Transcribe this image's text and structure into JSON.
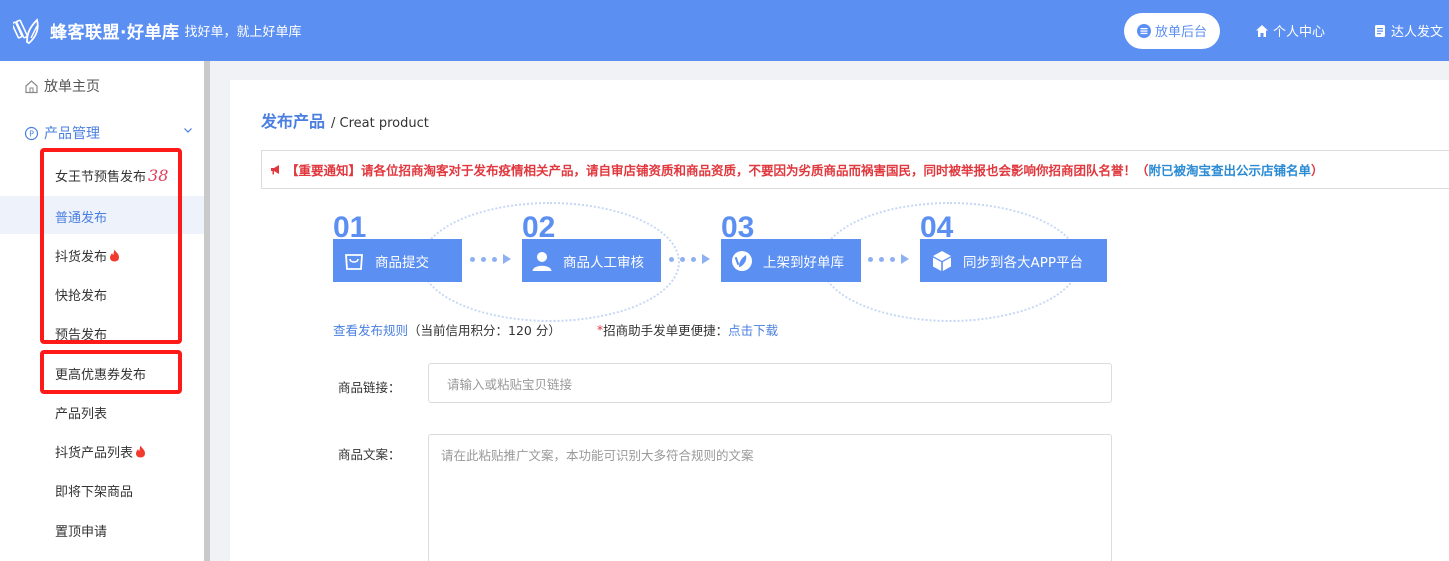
{
  "header": {
    "brand": "蜂客联盟·好单库",
    "slogan": "找好单，就上好单库",
    "nav": {
      "backend": "放单后台",
      "personal": "个人中心",
      "creator": "达人发文"
    },
    "colors": {
      "primary": "#5b8ff2"
    }
  },
  "sidebar": {
    "home": "放单主页",
    "product_mgmt": "产品管理",
    "items": [
      {
        "label": "女王节预售发布",
        "badge": "38"
      },
      {
        "label": "普通发布"
      },
      {
        "label": "抖货发布"
      },
      {
        "label": "快抢发布"
      },
      {
        "label": "预告发布"
      },
      {
        "label": "更高优惠券发布"
      },
      {
        "label": "产品列表"
      },
      {
        "label": "抖货产品列表"
      },
      {
        "label": "即将下架商品"
      },
      {
        "label": "置顶申请"
      }
    ]
  },
  "main": {
    "title": "发布产品",
    "subtitle": "/ Creat product",
    "notice": {
      "text": "【重要通知】请各位招商淘客对于发布疫情相关产品，请自审店铺资质和商品资质，不要因为劣质商品而祸害国民，同时被举报也会影响你招商团队名誉！",
      "paren_open": "（",
      "link": "附已被淘宝查出公示店铺名单",
      "paren_close": "）"
    },
    "steps": [
      {
        "num": "01",
        "label": "商品提交",
        "icon": "shopping-bag-icon"
      },
      {
        "num": "02",
        "label": "商品人工审核",
        "icon": "user-icon"
      },
      {
        "num": "03",
        "label": "上架到好单库",
        "icon": "logo-icon"
      },
      {
        "num": "04",
        "label": "同步到各大APP平台",
        "icon": "cube-icon"
      }
    ],
    "rules": {
      "link": "查看发布规则",
      "credit": "（当前信用积分：120 分）",
      "asterisk": "*",
      "helper": "招商助手发单更便捷：",
      "download": "点击下载"
    },
    "form": {
      "link_label": "商品链接：",
      "link_placeholder": "请输入或粘贴宝贝链接",
      "copy_label": "商品文案：",
      "copy_placeholder": "请在此粘贴推广文案，本功能可识别大多符合规则的文案"
    }
  }
}
